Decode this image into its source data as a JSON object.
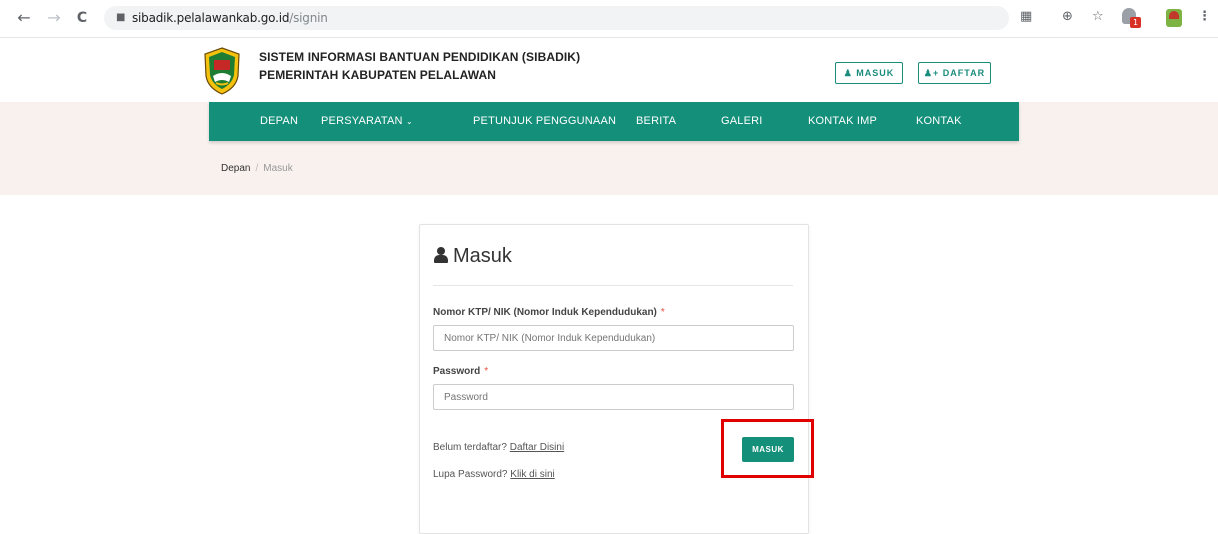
{
  "browser": {
    "back": "←",
    "forward": "→",
    "reload": "C",
    "url_host": "sibadik.pelalawankab.go.id",
    "url_path": "/signin",
    "icons": [
      "translate-icon",
      "zoom-icon",
      "star-icon",
      "extension-icon"
    ],
    "extension_badge": "1"
  },
  "header": {
    "title_line1": "SISTEM INFORMASI BANTUAN PENDIDIKAN (SIBADIK)",
    "title_line2": "PEMERINTAH KABUPATEN PELALAWAN",
    "login_label": "MASUK",
    "register_label": "DAFTAR"
  },
  "nav": {
    "items": [
      {
        "label": "DEPAN"
      },
      {
        "label": "PERSYARATAN"
      },
      {
        "label": "PETUNJUK PENGGUNAAN"
      },
      {
        "label": "BERITA"
      },
      {
        "label": "GALERI"
      },
      {
        "label": "KONTAK IMP"
      },
      {
        "label": "KONTAK"
      }
    ],
    "bg_color": "#148f7a"
  },
  "breadcrumb": {
    "home": "Depan",
    "separator": "/",
    "current": "Masuk"
  },
  "form": {
    "title": "Masuk",
    "nik_label": "Nomor KTP/ NIK (Nomor Induk Kependudukan)",
    "nik_placeholder": "Nomor KTP/ NIK (Nomor Induk Kependudukan)",
    "password_label": "Password",
    "password_placeholder": "Password",
    "required_mark": "*",
    "register_prompt": "Belum terdaftar?",
    "register_link": "Daftar Disini",
    "forgot_prompt": "Lupa Password?",
    "forgot_link": "Klik di sini",
    "submit_label": "MASUK"
  },
  "colors": {
    "accent": "#148f7a",
    "highlight": "#e00000",
    "band": "#f8f1ed"
  }
}
